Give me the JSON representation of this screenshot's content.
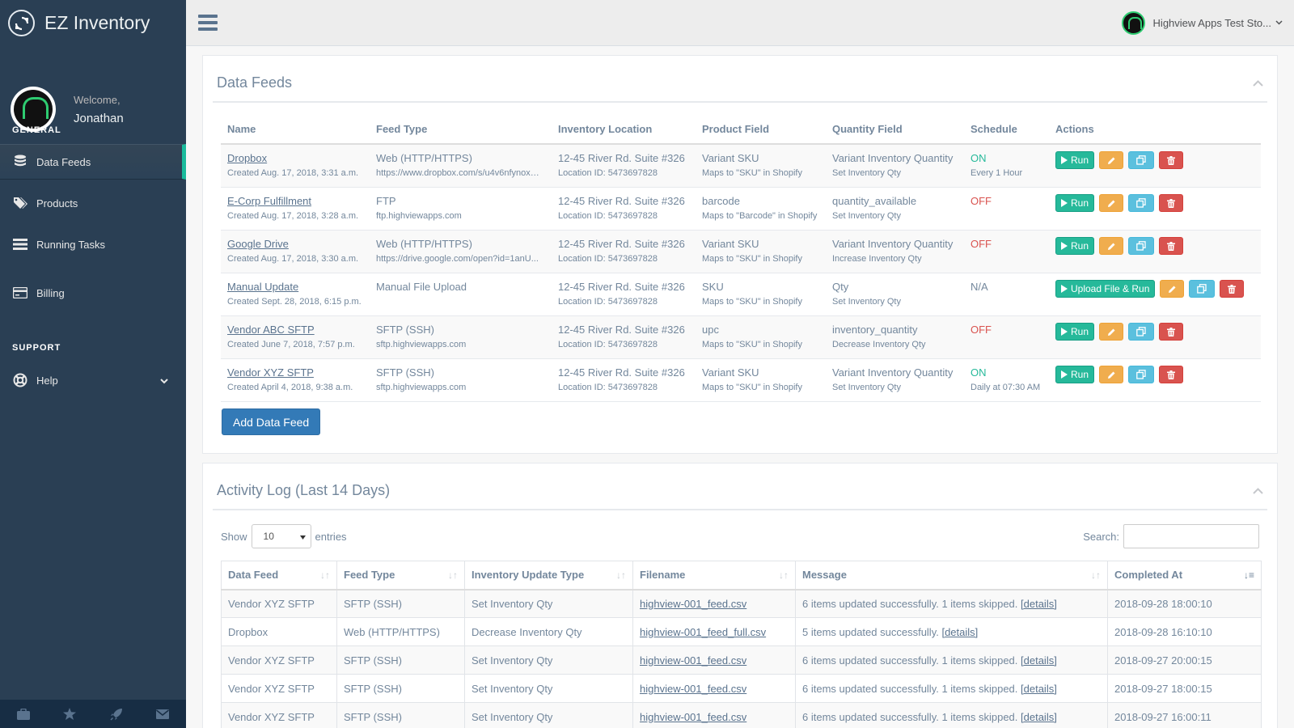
{
  "app": {
    "name": "EZ Inventory"
  },
  "profile": {
    "welcome": "Welcome,",
    "name": "Jonathan"
  },
  "sidebar": {
    "general_label": "GENERAL",
    "support_label": "SUPPORT",
    "items": [
      {
        "label": "Data Feeds",
        "icon": "database-icon"
      },
      {
        "label": "Products",
        "icon": "tags-icon"
      },
      {
        "label": "Running Tasks",
        "icon": "tasks-icon"
      },
      {
        "label": "Billing",
        "icon": "credit-card-icon"
      },
      {
        "label": "Help",
        "icon": "life-ring-icon"
      }
    ],
    "footer_icons": [
      "briefcase-icon",
      "star-icon",
      "rocket-icon",
      "envelope-icon"
    ]
  },
  "topnav": {
    "store_name": "Highview Apps Test Sto..."
  },
  "feeds_panel": {
    "title": "Data Feeds",
    "columns": [
      "Name",
      "Feed Type",
      "Inventory Location",
      "Product Field",
      "Quantity Field",
      "Schedule",
      "Actions"
    ],
    "rows": [
      {
        "name": "Dropbox",
        "created": "Created Aug. 17, 2018, 3:31 a.m.",
        "feed_type": "Web (HTTP/HTTPS)",
        "feed_sub": "https://www.dropbox.com/s/u4v6nfynoxe...",
        "location": "12-45 River Rd. Suite #326",
        "location_sub": "Location ID: 5473697828",
        "product": "Variant SKU",
        "product_sub": "Maps to \"SKU\" in Shopify",
        "quantity": "Variant Inventory Quantity",
        "quantity_sub": "Set Inventory Qty",
        "schedule": "ON",
        "schedule_sub": "Every 1 Hour",
        "run_label": "Run"
      },
      {
        "name": "E-Corp Fulfillment",
        "created": "Created Aug. 17, 2018, 3:28 a.m.",
        "feed_type": "FTP",
        "feed_sub": "ftp.highviewapps.com",
        "location": "12-45 River Rd. Suite #326",
        "location_sub": "Location ID: 5473697828",
        "product": "barcode",
        "product_sub": "Maps to \"Barcode\" in Shopify",
        "quantity": "quantity_available",
        "quantity_sub": "Set Inventory Qty",
        "schedule": "OFF",
        "schedule_sub": "",
        "run_label": "Run"
      },
      {
        "name": "Google Drive",
        "created": "Created Aug. 17, 2018, 3:30 a.m.",
        "feed_type": "Web (HTTP/HTTPS)",
        "feed_sub": "https://drive.google.com/open?id=1anU...",
        "location": "12-45 River Rd. Suite #326",
        "location_sub": "Location ID: 5473697828",
        "product": "Variant SKU",
        "product_sub": "Maps to \"SKU\" in Shopify",
        "quantity": "Variant Inventory Quantity",
        "quantity_sub": "Increase Inventory Qty",
        "schedule": "OFF",
        "schedule_sub": "",
        "run_label": "Run"
      },
      {
        "name": "Manual Update",
        "created": "Created Sept. 28, 2018, 6:15 p.m.",
        "feed_type": "Manual File Upload",
        "feed_sub": "",
        "location": "12-45 River Rd. Suite #326",
        "location_sub": "Location ID: 5473697828",
        "product": "SKU",
        "product_sub": "Maps to \"SKU\" in Shopify",
        "quantity": "Qty",
        "quantity_sub": "Set Inventory Qty",
        "schedule": "N/A",
        "schedule_sub": "",
        "run_label": "Upload File & Run"
      },
      {
        "name": "Vendor ABC SFTP",
        "created": "Created June 7, 2018, 7:57 p.m.",
        "feed_type": "SFTP (SSH)",
        "feed_sub": "sftp.highviewapps.com",
        "location": "12-45 River Rd. Suite #326",
        "location_sub": "Location ID: 5473697828",
        "product": "upc",
        "product_sub": "Maps to \"SKU\" in Shopify",
        "quantity": "inventory_quantity",
        "quantity_sub": "Decrease Inventory Qty",
        "schedule": "OFF",
        "schedule_sub": "",
        "run_label": "Run"
      },
      {
        "name": "Vendor XYZ SFTP",
        "created": "Created April 4, 2018, 9:38 a.m.",
        "feed_type": "SFTP (SSH)",
        "feed_sub": "sftp.highviewapps.com",
        "location": "12-45 River Rd. Suite #326",
        "location_sub": "Location ID: 5473697828",
        "product": "Variant SKU",
        "product_sub": "Maps to \"SKU\" in Shopify",
        "quantity": "Variant Inventory Quantity",
        "quantity_sub": "Set Inventory Qty",
        "schedule": "ON",
        "schedule_sub": "Daily at 07:30 AM",
        "run_label": "Run"
      }
    ],
    "add_label": "Add Data Feed"
  },
  "log_panel": {
    "title": "Activity Log (Last 14 Days)",
    "show_label": "Show",
    "entries_value": "10",
    "entries_label": "entries",
    "search_label": "Search:",
    "columns": [
      "Data Feed",
      "Feed Type",
      "Inventory Update Type",
      "Filename",
      "Message",
      "Completed At"
    ],
    "details_label": "[details]",
    "rows": [
      {
        "feed": "Vendor XYZ SFTP",
        "type": "SFTP (SSH)",
        "update": "Set Inventory Qty",
        "file": "highview-001_feed.csv",
        "message": "6 items updated successfully. 1 items skipped.",
        "completed": "2018-09-28 18:00:10"
      },
      {
        "feed": "Dropbox",
        "type": "Web (HTTP/HTTPS)",
        "update": "Decrease Inventory Qty",
        "file": "highview-001_feed_full.csv",
        "message": "5 items updated successfully.",
        "completed": "2018-09-28 16:10:10"
      },
      {
        "feed": "Vendor XYZ SFTP",
        "type": "SFTP (SSH)",
        "update": "Set Inventory Qty",
        "file": "highview-001_feed.csv",
        "message": "6 items updated successfully. 1 items skipped.",
        "completed": "2018-09-27 20:00:15"
      },
      {
        "feed": "Vendor XYZ SFTP",
        "type": "SFTP (SSH)",
        "update": "Set Inventory Qty",
        "file": "highview-001_feed.csv",
        "message": "6 items updated successfully. 1 items skipped.",
        "completed": "2018-09-27 18:00:15"
      },
      {
        "feed": "Vendor XYZ SFTP",
        "type": "SFTP (SSH)",
        "update": "Set Inventory Qty",
        "file": "highview-001_feed.csv",
        "message": "6 items updated successfully. 1 items skipped.",
        "completed": "2018-09-27 16:00:11"
      }
    ]
  },
  "colors": {
    "sidebar": "#2a3f54",
    "accent": "#1abb9c",
    "run": "#26b99a",
    "edit": "#f0ad4e",
    "copy": "#5bc0de",
    "delete": "#d9534f",
    "primary": "#337ab7"
  }
}
